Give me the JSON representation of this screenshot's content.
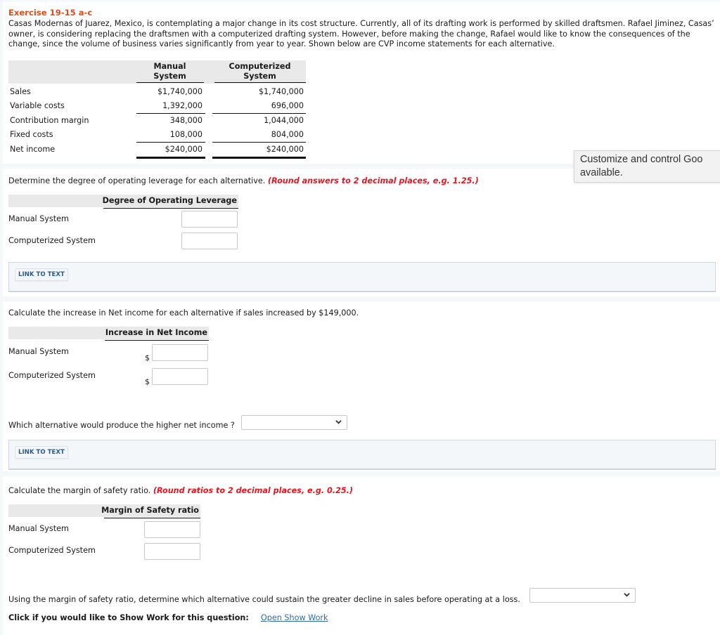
{
  "header": {
    "title": "Exercise 19-15 a-c",
    "intro": "Casas Modernas of Juarez, Mexico, is contemplating a major change in its cost structure. Currently, all of its drafting work is performed by skilled draftsmen. Rafael Jiminez, Casas’ owner, is considering replacing the draftsmen with a computerized drafting system. However, before making the change, Rafael would like to know the consequences of the change, since the volume of business varies significantly from year to year. Shown below are CVP income statements for each alternative."
  },
  "cvp_table": {
    "col1_line1": "Manual",
    "col1_line2": "System",
    "col2_line1": "Computerized",
    "col2_line2": "System",
    "rows": [
      {
        "label": "Sales",
        "manual": "$1,740,000",
        "computerized": "$1,740,000"
      },
      {
        "label": "Variable costs",
        "manual": "1,392,000",
        "computerized": "696,000"
      },
      {
        "label": "Contribution margin",
        "manual": "348,000",
        "computerized": "1,044,000"
      },
      {
        "label": "Fixed costs",
        "manual": "108,000",
        "computerized": "804,000"
      },
      {
        "label": "Net income",
        "manual": "$240,000",
        "computerized": "$240,000"
      }
    ]
  },
  "tooltip": {
    "line1": "Customize and control Goo",
    "line2": "available."
  },
  "q_dol": {
    "text": "Determine the degree of operating leverage for each alternative. ",
    "hint": "(Round answers to 2 decimal places, e.g. 1.25.)",
    "column": "Degree of Operating Leverage",
    "rows": [
      {
        "label": "Manual System",
        "value": ""
      },
      {
        "label": "Computerized System",
        "value": ""
      }
    ]
  },
  "link_to_text_1": "LINK TO TEXT",
  "q_increase": {
    "text": "Calculate the increase in Net income for each alternative if sales increased by $149,000.",
    "column": "Increase in Net Income",
    "currency": "$",
    "rows": [
      {
        "label": "Manual System",
        "value": ""
      },
      {
        "label": "Computerized System",
        "value": ""
      }
    ]
  },
  "q_higher": {
    "text": "Which alternative would produce the higher net income ?",
    "selected": ""
  },
  "link_to_text_2": "LINK TO TEXT",
  "q_mos": {
    "text": "Calculate the margin of safety ratio. ",
    "hint": "(Round ratios to 2 decimal places, e.g. 0.25.)",
    "column": "Margin of Safety ratio",
    "rows": [
      {
        "label": "Manual System",
        "value": ""
      },
      {
        "label": "Computerized System",
        "value": ""
      }
    ]
  },
  "q_decline": {
    "text": "Using the margin of safety ratio, determine which alternative could sustain the greater decline in sales before operating at a loss.",
    "selected": ""
  },
  "show_work": {
    "label": "Click if you would like to Show Work for this question:",
    "link": "Open Show Work"
  }
}
